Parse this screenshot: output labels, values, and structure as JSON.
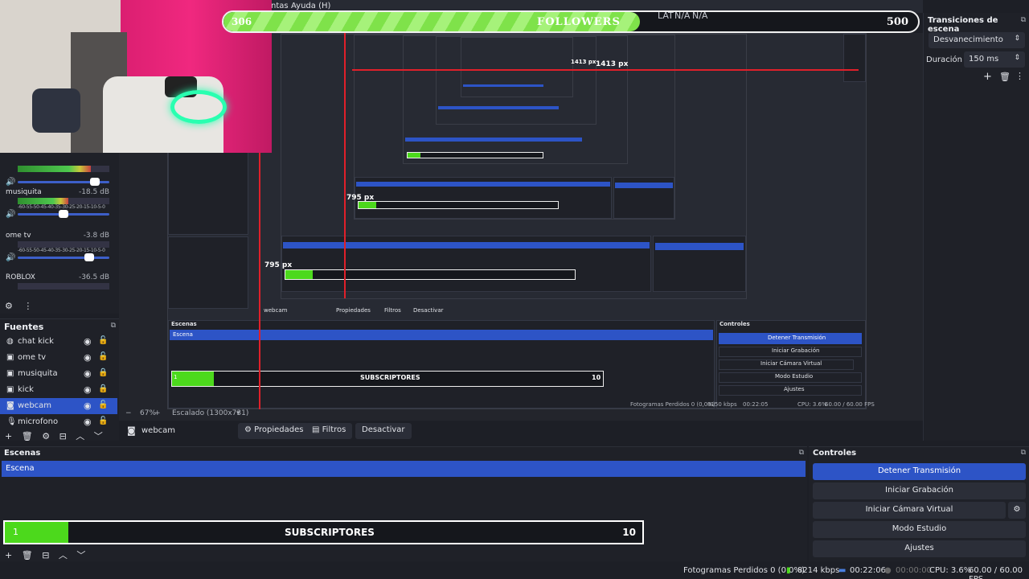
{
  "menu": {
    "items": [
      "ntas",
      "Ayuda (H)"
    ]
  },
  "followers_bar": {
    "start": "306",
    "title": "FOLLOWERS",
    "goal": "500",
    "fill_fraction": 0.6
  },
  "latency": {
    "label": "LAT",
    "val1": "N/A",
    "val2": "N/A"
  },
  "mixer": {
    "channels": [
      {
        "name": "",
        "db": "",
        "level": 0.8,
        "volume": 0.84
      },
      {
        "name": "musiquita",
        "db": "-18.5 dB",
        "level": 0.55,
        "volume": 0.5
      },
      {
        "name": "ome tv",
        "db": "-3.8 dB",
        "level": 0.0,
        "volume": 0.78
      },
      {
        "name": "ROBLOX",
        "db": "-36.5 dB",
        "level": 0.0,
        "volume": 0.0
      }
    ],
    "scale": "-60-55-50-45-40-35-30-25-20-15-10-5-0"
  },
  "sources": {
    "title": "Fuentes",
    "items": [
      {
        "label": "chat kick",
        "icon": "globe-icon",
        "active": false
      },
      {
        "label": "ome tv",
        "icon": "window-icon",
        "active": false
      },
      {
        "label": "musiquita",
        "icon": "window-icon",
        "active": false
      },
      {
        "label": "kick",
        "icon": "window-icon",
        "active": false
      },
      {
        "label": "webcam",
        "icon": "camera-icon",
        "active": true
      },
      {
        "label": "microfono",
        "icon": "mic-icon",
        "active": false
      }
    ]
  },
  "transitions": {
    "title": "Transiciones de escena",
    "type": "Desvanecimiento",
    "duration_label": "Duración",
    "duration_value": "150 ms"
  },
  "preview": {
    "zoom": "67%",
    "scaled": "Escalado (1300x731)",
    "labels": {
      "px1": "1413 px",
      "px2": "795 px",
      "px3": "795 px",
      "px4": "1413 px"
    },
    "inner_sub": {
      "cur": "1",
      "title": "SUBSCRIPTORES",
      "goal": "10"
    },
    "inner_controls": [
      "Detener Transmisión",
      "Iniciar Grabación",
      "Iniciar Cámara Virtual",
      "Modo Estudio",
      "Ajustes"
    ],
    "inner_scenes_title": "Escenas",
    "inner_controls_title": "Controles",
    "inner_scene_item": "Escena",
    "inner_status": "Fotogramas Perdidos 0 (0,0%)",
    "inner_kbps": "8150 kbps",
    "inner_time": "00:22:05",
    "inner_cpu": "CPU: 3.6%",
    "inner_fps": "60.00 / 60.00 FPS",
    "inner_source": "webcam",
    "inner_props": "Propiedades",
    "inner_filters": "Filtros",
    "inner_deactivate": "Desactivar"
  },
  "source_toolbar": {
    "source": "webcam",
    "props": "Propiedades",
    "filters": "Filtros",
    "deactivate": "Desactivar"
  },
  "scenes": {
    "title": "Escenas",
    "items": [
      "Escena"
    ]
  },
  "subscribers": {
    "current": "1",
    "title": "SUBSCRIPTORES",
    "goal": "10",
    "fill_fraction": 0.1
  },
  "controls": {
    "title": "Controles",
    "buttons": [
      "Detener Transmisión",
      "Iniciar Grabación",
      "Iniciar Cámara Virtual",
      "Modo Estudio",
      "Ajustes"
    ]
  },
  "status": {
    "frames": "Fotogramas Perdidos 0 (0.0%)",
    "kbps": "8214 kbps",
    "stream_time": "00:22:06",
    "rec_time": "00:00:00",
    "cpu": "CPU: 3.6%",
    "fps": "60.00 / 60.00 FPS"
  },
  "colors": {
    "accent": "#2d54c6",
    "green": "#4cd91c",
    "red": "#e0202a"
  }
}
